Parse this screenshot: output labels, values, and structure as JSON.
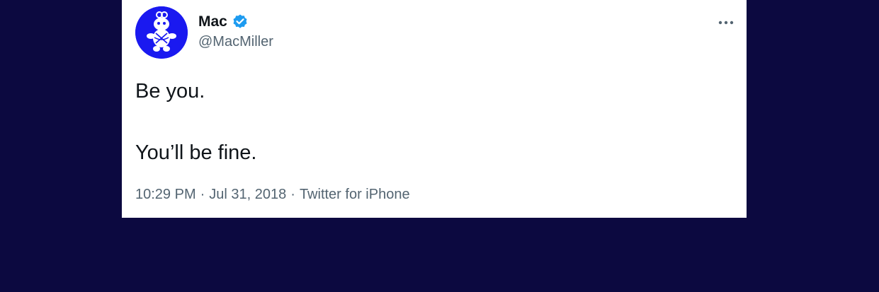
{
  "tweet": {
    "author": {
      "display_name": "Mac",
      "handle": "@MacMiller",
      "verified_icon": "verified-badge-icon",
      "avatar_color": "#1a19f0"
    },
    "text_lines": [
      "Be you.",
      "You’ll be fine."
    ],
    "meta": {
      "time": "10:29 PM",
      "date": "Jul 31, 2018",
      "source": "Twitter for iPhone",
      "separator": "·"
    },
    "more_icon": "more-horizontal-icon"
  },
  "colors": {
    "background": "#0c0940",
    "card": "#ffffff",
    "text_primary": "#0f1419",
    "text_secondary": "#536471",
    "verified": "#1d9bf0"
  }
}
